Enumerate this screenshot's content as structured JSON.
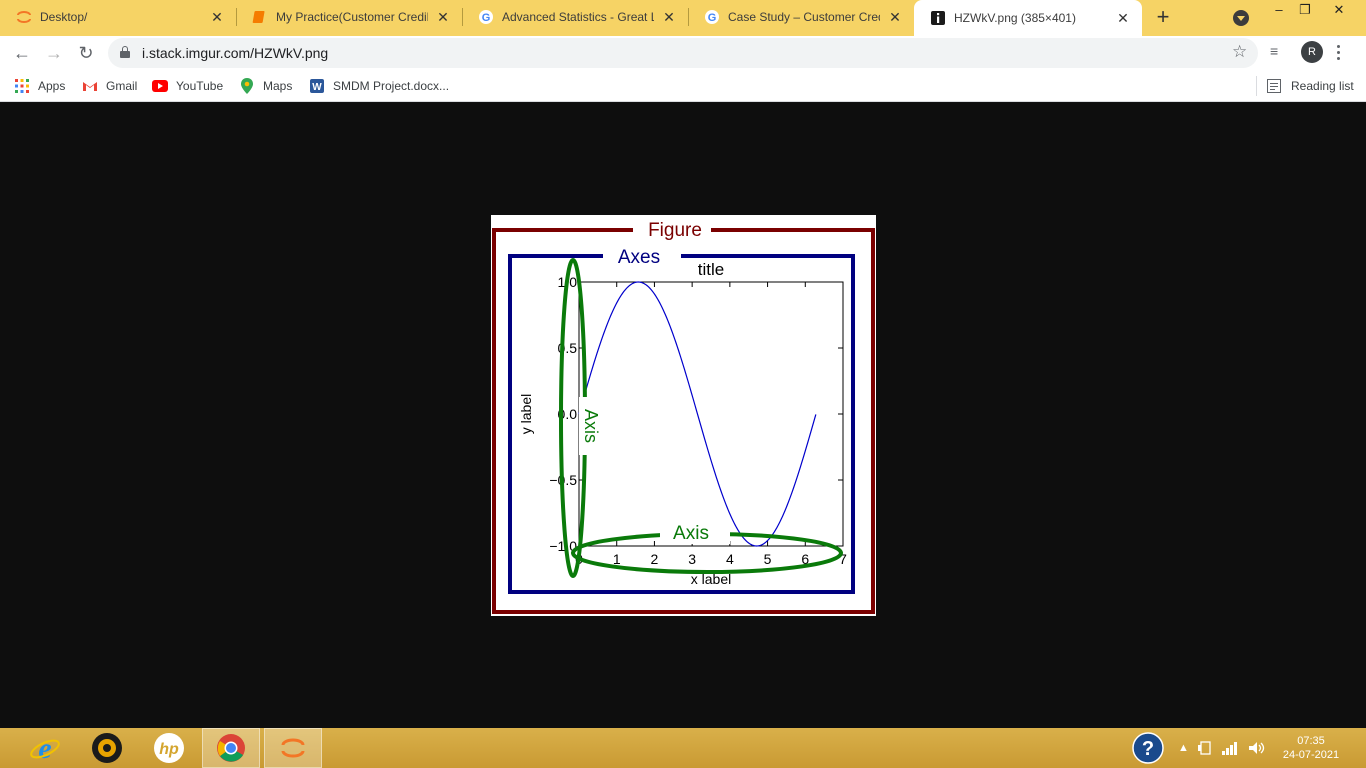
{
  "browser": {
    "tabs": [
      {
        "title": "Desktop/",
        "favicon": "jupyter-icon"
      },
      {
        "title": "My Practice(Customer Credibil",
        "favicon": "notebook-icon"
      },
      {
        "title": "Advanced Statistics - Great Lea",
        "favicon": "google-icon"
      },
      {
        "title": "Case Study – Customer Credib",
        "favicon": "google-icon"
      },
      {
        "title": "HZWkV.png (385×401)",
        "favicon": "imgur-icon",
        "active": true
      }
    ],
    "new_tab": "+",
    "url": "i.stack.imgur.com/HZWkV.png",
    "profile_initial": "R"
  },
  "bookmarks": [
    {
      "label": "Apps",
      "icon": "apps-grid-icon"
    },
    {
      "label": "Gmail",
      "icon": "gmail-icon"
    },
    {
      "label": "YouTube",
      "icon": "youtube-icon"
    },
    {
      "label": "Maps",
      "icon": "maps-icon"
    },
    {
      "label": "SMDM Project.docx...",
      "icon": "word-icon"
    }
  ],
  "reading_list": "Reading list",
  "chart_data": {
    "type": "line",
    "title": "title",
    "xlabel": "x label",
    "ylabel": "y label",
    "xlim": [
      0,
      7
    ],
    "ylim": [
      -1.0,
      1.0
    ],
    "xticks": [
      "0",
      "1",
      "2",
      "3",
      "4",
      "5",
      "6",
      "7"
    ],
    "yticks": [
      "−1.0",
      "−0.5",
      "0.0",
      "0.5",
      "1.0"
    ],
    "series": [
      {
        "function": "sin(x)",
        "x_range": [
          0,
          6.28
        ],
        "color": "#0000cc"
      }
    ],
    "annotations": {
      "figure": "Figure",
      "axes": "Axes",
      "y_axis": "Axis",
      "x_axis": "Axis"
    },
    "colors": {
      "figure": "#7a0000",
      "axes": "#000080",
      "axis": "#0a7a0a"
    }
  },
  "taskbar": {
    "apps": [
      "internet-explorer-icon",
      "media-player-icon",
      "hp-icon",
      "chrome-icon",
      "jupyter-icon"
    ],
    "time": "07:35",
    "date": "24-07-2021"
  }
}
